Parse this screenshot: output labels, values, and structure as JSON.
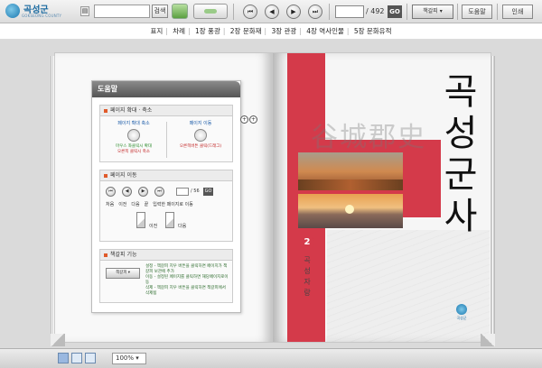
{
  "toolbar": {
    "logo_text": "곡성군",
    "logo_sub": "GOKSEONG COUNTY",
    "search_value": "",
    "search_label": "검색",
    "page_value": "",
    "page_total": "/ 492",
    "go_label": "GO",
    "bookmark_label": "책갈피 ▾",
    "help_label": "도움말",
    "print_label": "인쇄"
  },
  "chapters": [
    "표지",
    "차례",
    "1장 풍광",
    "2장 문화재",
    "3장 관광",
    "4장 역사인물",
    "5장 문화유적"
  ],
  "help": {
    "title": "도움말",
    "zoom": {
      "title": "페이지 확대 · 축소",
      "left_label": "페이지 확대 축소",
      "left_note_1": "마우스 좌클릭시 확대",
      "left_note_2": "오른쪽 클릭시 축소",
      "right_label": "페이지 이동",
      "right_note": "오른쪽버튼 클릭(드래그)"
    },
    "move": {
      "title": "페이지 이동",
      "total": "/ 56",
      "go": "GO",
      "labels": [
        "처음",
        "이전",
        "다음",
        "끝",
        "입력한 페이지로 이동"
      ],
      "prev_caption": "이전",
      "next_caption": "다음"
    },
    "bookmark": {
      "title": "책갈피 기능",
      "button": "책갈피 ▾",
      "note_1": "설정 - 책갈피 지우 버튼을 클릭하면 페이지가 책갈피 보관에 추가",
      "note_2": "이동 - 설정된 페이지를 클릭하면 해당페이지로이동",
      "note_3": "삭제 - 책갈피 지우 버튼을 클릭하면 책갈피에서 삭제됨"
    }
  },
  "cover": {
    "title_chars": [
      "곡",
      "성",
      "군",
      "사"
    ],
    "hanja": "谷城郡史",
    "volume": "2",
    "volume_title_chars": [
      "곡",
      "성",
      "자",
      "랑"
    ],
    "emblem_text": "곡성군"
  },
  "bottom": {
    "zoom_value": "100% ▾"
  },
  "colors": {
    "cover_red": "#d43a4a",
    "brand_blue": "#1a78b0"
  }
}
